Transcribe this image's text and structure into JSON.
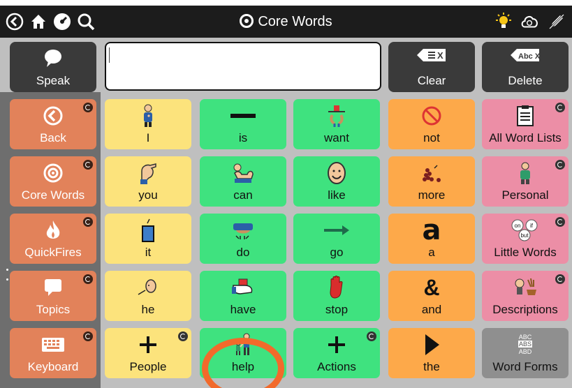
{
  "titlebar": {
    "title": "Core Words",
    "left_icons": [
      "back-arrow-icon",
      "home-icon",
      "speed-icon",
      "search-icon"
    ],
    "right_icons": [
      "lightbulb-icon",
      "cloud-sync-icon",
      "edit-off-icon"
    ]
  },
  "message_bar": {
    "speak_label": "Speak",
    "message_text": "",
    "clear_label": "Clear",
    "delete_label": "Delete",
    "clear_icon_text": "X",
    "delete_icon_text": "Abc X"
  },
  "nav": [
    {
      "label": "Back",
      "icon": "back-arrow-icon"
    },
    {
      "label": "Core Words",
      "icon": "target-icon"
    },
    {
      "label": "QuickFires",
      "icon": "flame-icon"
    },
    {
      "label": "Topics",
      "icon": "speech-bubble-icon"
    },
    {
      "label": "Keyboard",
      "icon": "keyboard-icon"
    }
  ],
  "grid": [
    [
      {
        "label": "I",
        "color": "yellow",
        "icon": "person-self-icon"
      },
      {
        "label": "is",
        "color": "green",
        "icon": "dash-icon"
      },
      {
        "label": "want",
        "color": "green",
        "icon": "want-icon"
      },
      {
        "label": "not",
        "color": "orange",
        "icon": "no-symbol-icon"
      },
      {
        "label": "All Word Lists",
        "color": "pink",
        "icon": "list-icon"
      }
    ],
    [
      {
        "label": "you",
        "color": "yellow",
        "icon": "point-you-icon"
      },
      {
        "label": "can",
        "color": "green",
        "icon": "strong-arm-icon"
      },
      {
        "label": "like",
        "color": "green",
        "icon": "smile-face-icon"
      },
      {
        "label": "more",
        "color": "orange",
        "icon": "more-icon"
      },
      {
        "label": "Personal",
        "color": "pink",
        "icon": "person-icon"
      }
    ],
    [
      {
        "label": "it",
        "color": "yellow",
        "icon": "it-icon"
      },
      {
        "label": "do",
        "color": "green",
        "icon": "do-icon"
      },
      {
        "label": "go",
        "color": "green",
        "icon": "arrow-right-icon"
      },
      {
        "label": "a",
        "color": "orange",
        "icon": "letter-a-icon"
      },
      {
        "label": "Little Words",
        "color": "pink",
        "icon": "little-words-icon"
      }
    ],
    [
      {
        "label": "he",
        "color": "yellow",
        "icon": "he-icon"
      },
      {
        "label": "have",
        "color": "green",
        "icon": "have-icon"
      },
      {
        "label": "stop",
        "color": "green",
        "icon": "stop-hand-icon"
      },
      {
        "label": "and",
        "color": "orange",
        "icon": "ampersand-icon"
      },
      {
        "label": "Descriptions",
        "color": "pink",
        "icon": "descriptions-icon"
      }
    ],
    [
      {
        "label": "People",
        "color": "yellow",
        "icon": "plus-icon"
      },
      {
        "label": "help",
        "color": "green",
        "icon": "help-icon"
      },
      {
        "label": "Actions",
        "color": "green",
        "icon": "plus-icon"
      },
      {
        "label": "the",
        "color": "orange",
        "icon": "play-triangle-icon"
      },
      {
        "label": "Word Forms",
        "color": "gray",
        "icon": "abc-icon"
      }
    ]
  ],
  "little_words_badges": [
    "on",
    "if",
    "but"
  ],
  "abc_badge": [
    "ABC",
    "ABS",
    "ABD"
  ],
  "letters": {
    "a": "a",
    "and": "&"
  }
}
